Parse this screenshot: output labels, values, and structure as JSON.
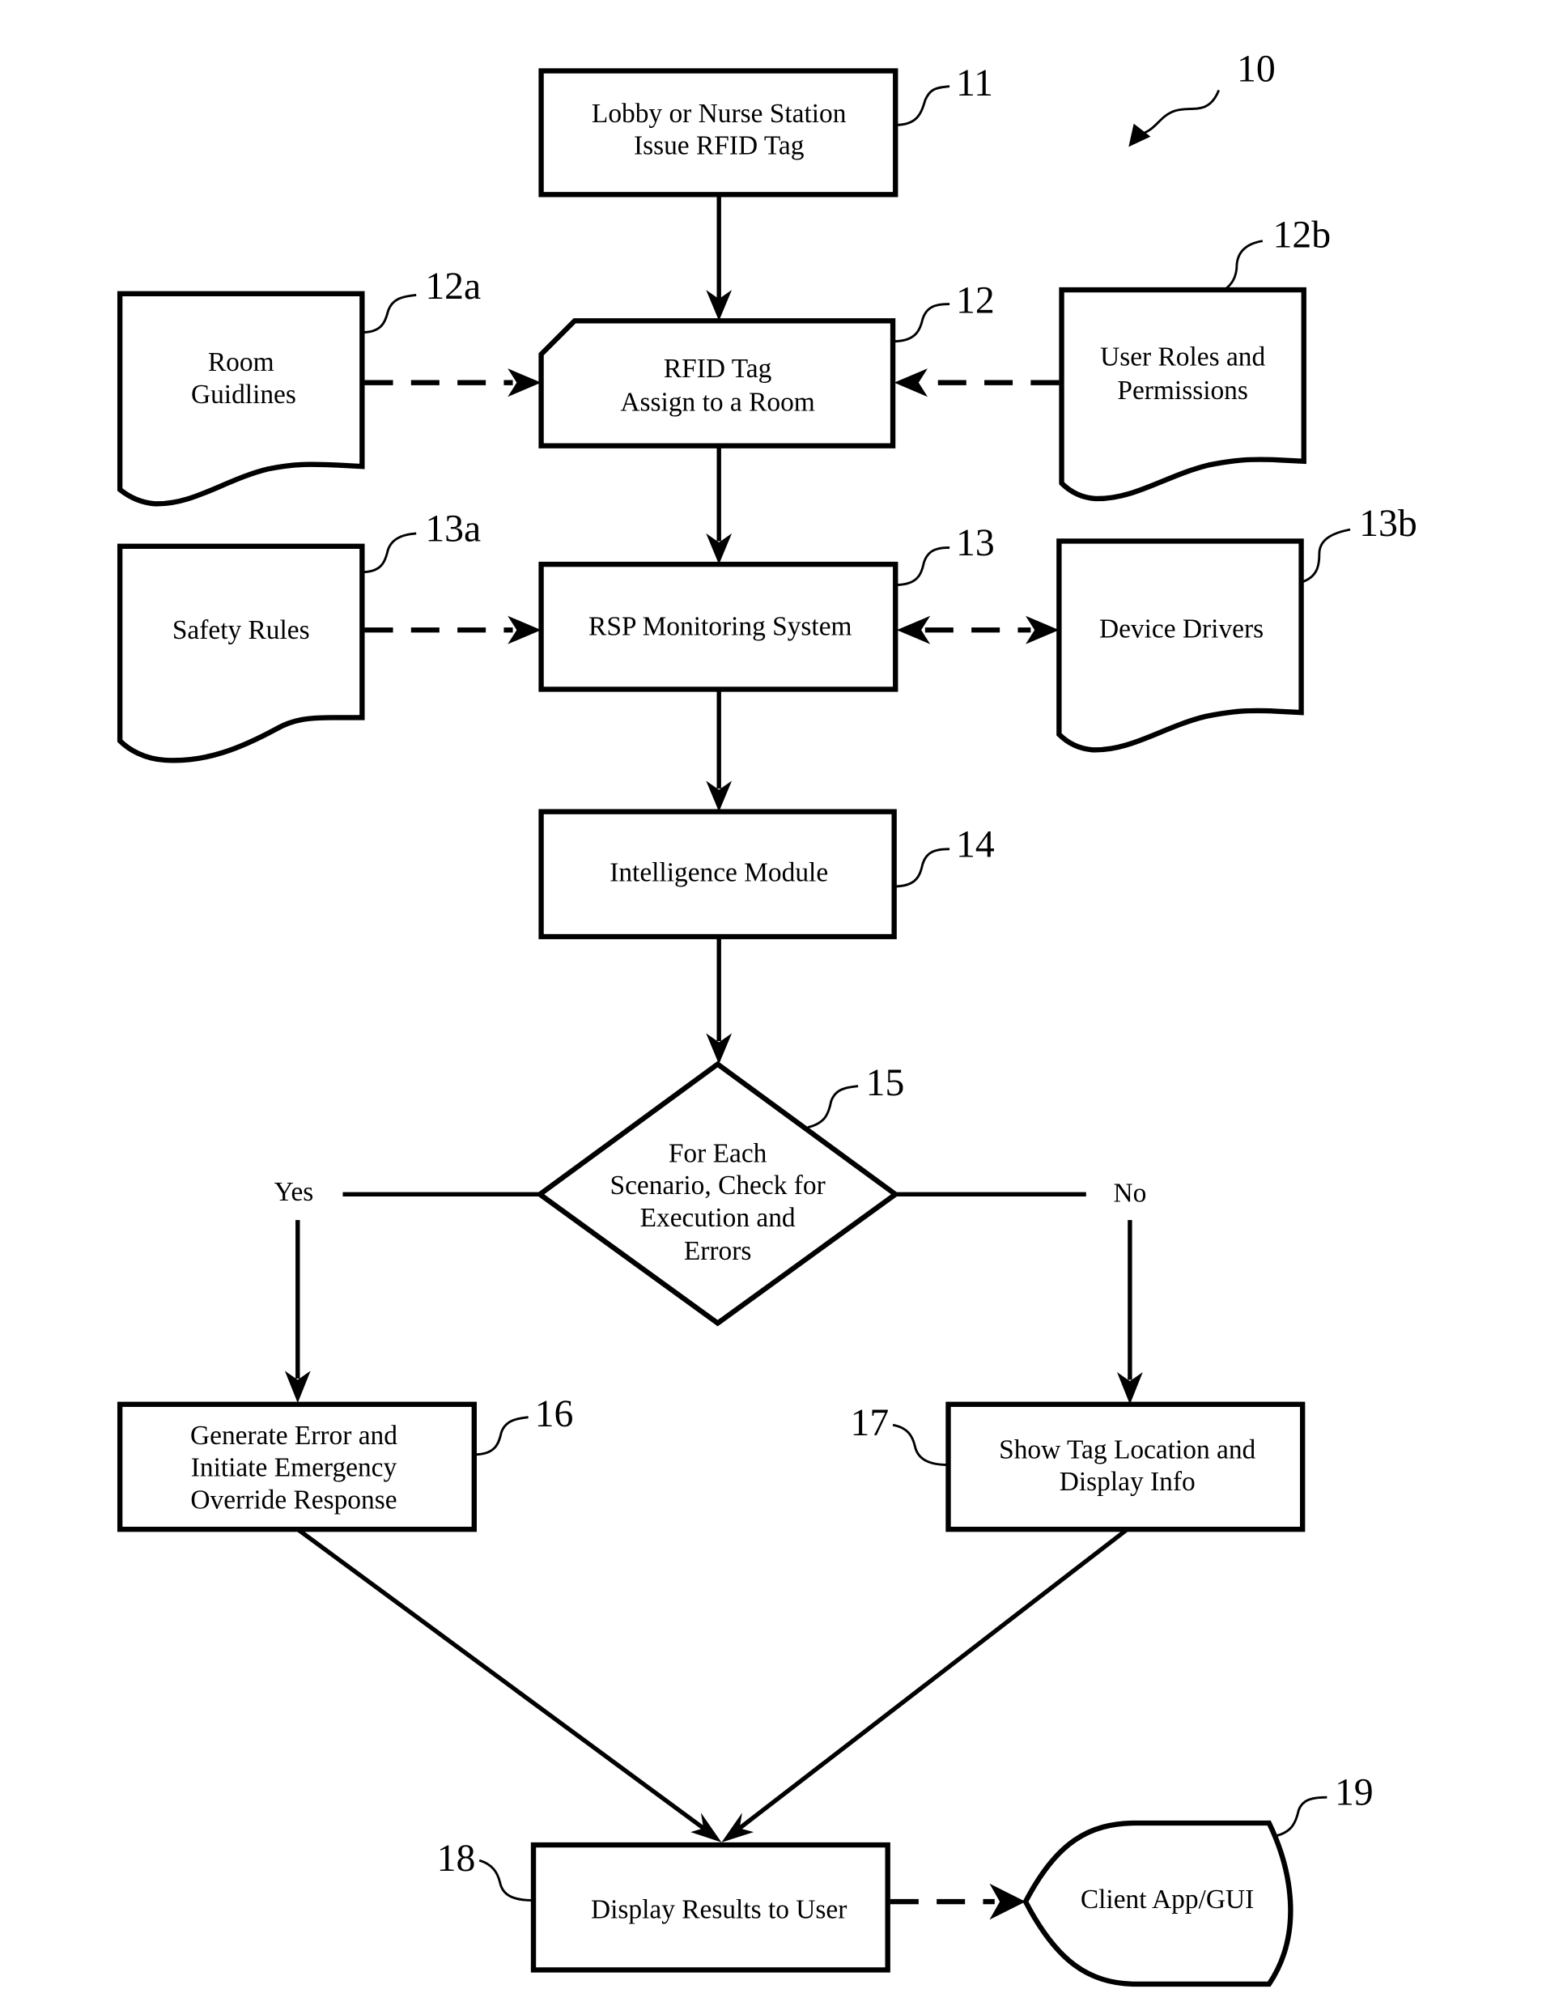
{
  "figure": {
    "reference_numeral": "10",
    "colors": {
      "stroke": "#000000",
      "background": "#ffffff"
    }
  },
  "nodes": {
    "n11": {
      "ref": "11",
      "type": "process",
      "lines": [
        "Lobby or Nurse Station",
        "Issue RFID Tag"
      ]
    },
    "n12": {
      "ref": "12",
      "type": "card",
      "lines": [
        "RFID Tag",
        "Assign to a Room"
      ]
    },
    "n12a": {
      "ref": "12a",
      "type": "document",
      "lines": [
        "Room",
        "Guidlines"
      ]
    },
    "n12b": {
      "ref": "12b",
      "type": "document",
      "lines": [
        "User Roles and",
        "Permissions"
      ]
    },
    "n13": {
      "ref": "13",
      "type": "process",
      "lines": [
        "RSP Monitoring System"
      ]
    },
    "n13a": {
      "ref": "13a",
      "type": "document",
      "lines": [
        "Safety Rules"
      ]
    },
    "n13b": {
      "ref": "13b",
      "type": "document",
      "lines": [
        "Device Drivers"
      ]
    },
    "n14": {
      "ref": "14",
      "type": "process",
      "lines": [
        "Intelligence Module"
      ]
    },
    "n15": {
      "ref": "15",
      "type": "decision",
      "lines": [
        "For Each",
        "Scenario, Check for",
        "Execution and",
        "Errors"
      ]
    },
    "n16": {
      "ref": "16",
      "type": "process",
      "lines": [
        "Generate Error and",
        "Initiate Emergency",
        "Override Response"
      ]
    },
    "n17": {
      "ref": "17",
      "type": "process",
      "lines": [
        "Show Tag Location and",
        "Display Info"
      ]
    },
    "n18": {
      "ref": "18",
      "type": "process",
      "lines": [
        "Display Results to User"
      ]
    },
    "n19": {
      "ref": "19",
      "type": "display",
      "lines": [
        "Client App/GUI"
      ]
    }
  },
  "branches": {
    "yes": "Yes",
    "no": "No"
  },
  "edges": [
    {
      "from": "11",
      "to": "12",
      "style": "solid"
    },
    {
      "from": "12a",
      "to": "12",
      "style": "dashed"
    },
    {
      "from": "12b",
      "to": "12",
      "style": "dashed"
    },
    {
      "from": "12",
      "to": "13",
      "style": "solid"
    },
    {
      "from": "13a",
      "to": "13",
      "style": "dashed"
    },
    {
      "from": "13",
      "to": "13b",
      "style": "dashed-bidirectional"
    },
    {
      "from": "13",
      "to": "14",
      "style": "solid"
    },
    {
      "from": "14",
      "to": "15",
      "style": "solid"
    },
    {
      "from": "15",
      "to": "16",
      "style": "solid",
      "label": "Yes"
    },
    {
      "from": "15",
      "to": "17",
      "style": "solid",
      "label": "No"
    },
    {
      "from": "16",
      "to": "18",
      "style": "solid"
    },
    {
      "from": "17",
      "to": "18",
      "style": "solid"
    },
    {
      "from": "18",
      "to": "19",
      "style": "dashed"
    }
  ]
}
